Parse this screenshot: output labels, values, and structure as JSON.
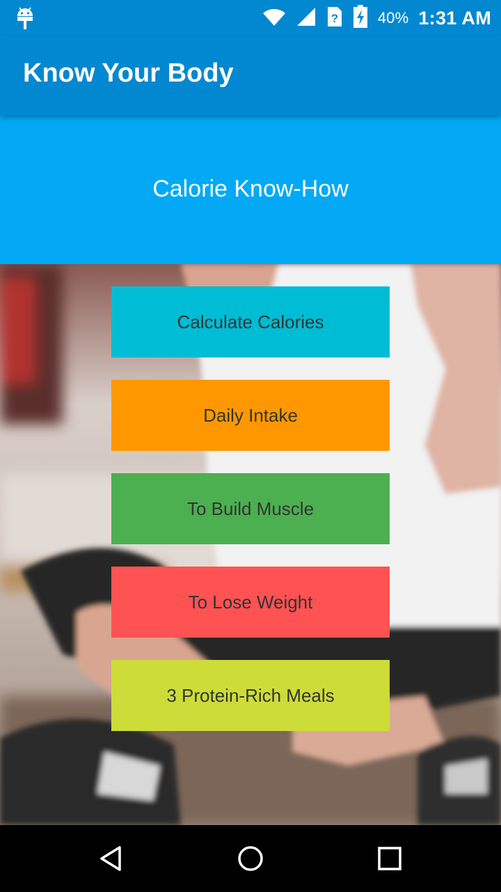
{
  "status_bar": {
    "battery_percent": "40%",
    "time": "1:31 AM",
    "icons": [
      "android-debug-icon",
      "wifi-icon",
      "cell-signal-icon",
      "unknown-sim-icon",
      "battery-charging-icon"
    ]
  },
  "app_bar": {
    "title": "Know Your Body"
  },
  "hero": {
    "title": "Calorie Know-How"
  },
  "menu": {
    "items": [
      {
        "label": "Calculate Calories",
        "color": "#00bcd4"
      },
      {
        "label": "Daily Intake",
        "color": "#ff9800"
      },
      {
        "label": "To Build Muscle",
        "color": "#4caf50"
      },
      {
        "label": "To Lose Weight",
        "color": "#ff5252"
      },
      {
        "label": "3 Protein-Rich Meals",
        "color": "#cddc39"
      }
    ]
  },
  "nav_bar": {
    "icons": [
      "back-icon",
      "home-icon",
      "recents-icon"
    ]
  },
  "colors": {
    "primary_dark": "#0288d1",
    "hero_blue": "#03a9f4"
  }
}
